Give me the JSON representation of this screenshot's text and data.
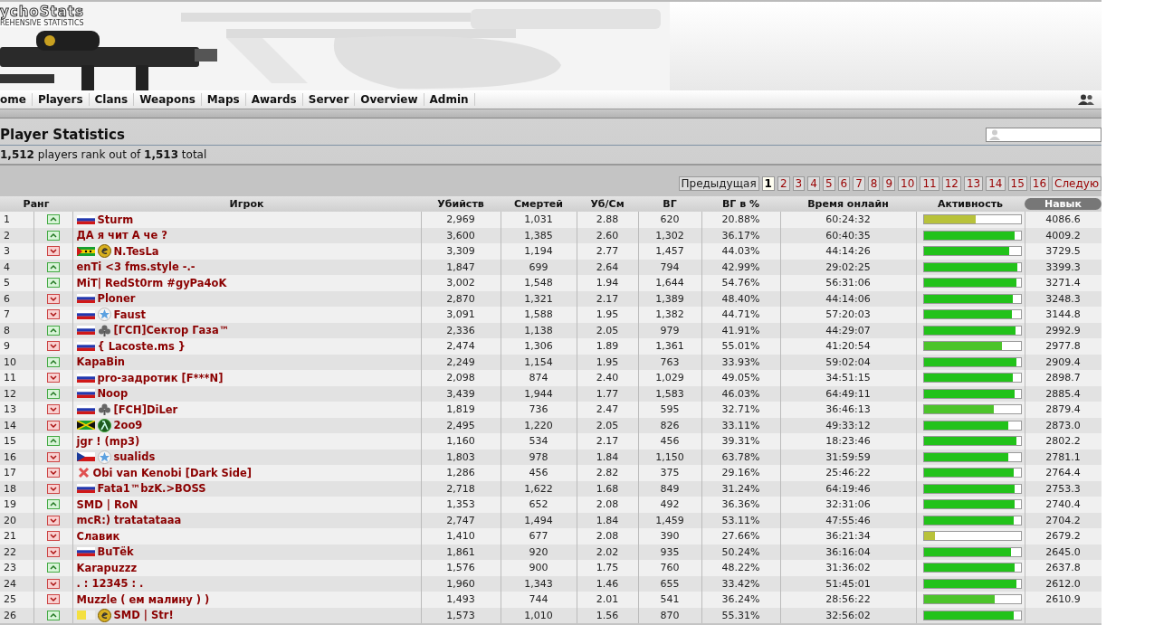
{
  "header": {
    "logo": "ychoStats",
    "tagline": "REHENSIVE STATISTICS"
  },
  "nav": [
    {
      "label": "ome"
    },
    {
      "label": "Players"
    },
    {
      "label": "Clans"
    },
    {
      "label": "Weapons"
    },
    {
      "label": "Maps"
    },
    {
      "label": "Awards"
    },
    {
      "label": "Server"
    },
    {
      "label": "Overview"
    },
    {
      "label": "Admin"
    }
  ],
  "title": "Player Statistics",
  "summary": "**1,512** players rank out of **1,513** total",
  "pagination": {
    "previous": "Предыдущая",
    "next": "Следую",
    "pages": [
      {
        "label": "1",
        "selected": true
      },
      {
        "label": "2",
        "selected": false
      },
      {
        "label": "3",
        "selected": false
      },
      {
        "label": "4",
        "selected": false
      },
      {
        "label": "5",
        "selected": false
      },
      {
        "label": "6",
        "selected": false
      },
      {
        "label": "7",
        "selected": false
      },
      {
        "label": "8",
        "selected": false
      },
      {
        "label": "9",
        "selected": false
      },
      {
        "label": "10",
        "selected": false
      },
      {
        "label": "11",
        "selected": false
      },
      {
        "label": "12",
        "selected": false
      },
      {
        "label": "13",
        "selected": false
      },
      {
        "label": "14",
        "selected": false
      },
      {
        "label": "15",
        "selected": false
      },
      {
        "label": "16",
        "selected": false
      }
    ]
  },
  "table": {
    "columns": [
      {
        "label": "Ранг",
        "sorted": false
      },
      {
        "label": "Игрок",
        "sorted": false
      },
      {
        "label": "Убийств",
        "sorted": false
      },
      {
        "label": "Смертей",
        "sorted": false
      },
      {
        "label": "Уб/См",
        "sorted": false
      },
      {
        "label": "ВГ",
        "sorted": false
      },
      {
        "label": "ВГ в %",
        "sorted": false
      },
      {
        "label": "Время онлайн",
        "sorted": false
      },
      {
        "label": "Активность",
        "sorted": false
      },
      {
        "label": "Навык",
        "sorted": true
      }
    ],
    "rows": [
      {
        "rank": "1",
        "rising": true,
        "flag": {
          "kind": "ru"
        },
        "name": "Sturm",
        "kills": "2,969",
        "deaths": "1,031",
        "kd": "2.88",
        "hs": "620",
        "hs_pct": "20.88%",
        "online": "60:24:32",
        "activity": {
          "level": 0.54,
          "color": "#b8c23a"
        },
        "skill": "4086.6"
      },
      {
        "rank": "2",
        "rising": true,
        "name": "ДА я чит А че ?",
        "kills": "3,600",
        "deaths": "1,385",
        "kd": "2.60",
        "hs": "1,302",
        "hs_pct": "36.17%",
        "online": "60:40:35",
        "activity": {
          "level": 0.94,
          "color": "#22c21a"
        },
        "skill": "4009.2"
      },
      {
        "rank": "3",
        "rising": false,
        "flag": {
          "kind": "st"
        },
        "badge": {
          "kind": "coin"
        },
        "name": "N.TesLa",
        "kills": "3,309",
        "deaths": "1,194",
        "kd": "2.77",
        "hs": "1,457",
        "hs_pct": "44.03%",
        "online": "44:14:26",
        "activity": {
          "level": 0.88,
          "color": "#22c21a"
        },
        "skill": "3729.5"
      },
      {
        "rank": "4",
        "rising": true,
        "name": "enTi <3 fms.style -.-",
        "kills": "1,847",
        "deaths": "699",
        "kd": "2.64",
        "hs": "794",
        "hs_pct": "42.99%",
        "online": "29:02:25",
        "activity": {
          "level": 0.97,
          "color": "#22c21a"
        },
        "skill": "3399.3"
      },
      {
        "rank": "5",
        "rising": true,
        "name": "MiT| RedSt0rm #gyPa4oK",
        "kills": "3,002",
        "deaths": "1,548",
        "kd": "1.94",
        "hs": "1,644",
        "hs_pct": "54.76%",
        "online": "56:31:06",
        "activity": {
          "level": 0.96,
          "color": "#22c21a"
        },
        "skill": "3271.4"
      },
      {
        "rank": "6",
        "rising": false,
        "flag": {
          "kind": "ru"
        },
        "name": "Ploner",
        "kills": "2,870",
        "deaths": "1,321",
        "kd": "2.17",
        "hs": "1,389",
        "hs_pct": "48.40%",
        "online": "44:14:06",
        "activity": {
          "level": 0.92,
          "color": "#22c21a"
        },
        "skill": "3248.3"
      },
      {
        "rank": "7",
        "rising": false,
        "flag": {
          "kind": "ru"
        },
        "badge": {
          "kind": "star"
        },
        "name": "Faust",
        "kills": "3,091",
        "deaths": "1,588",
        "kd": "1.95",
        "hs": "1,382",
        "hs_pct": "44.71%",
        "online": "57:20:03",
        "activity": {
          "level": 0.91,
          "color": "#22c21a"
        },
        "skill": "3144.8"
      },
      {
        "rank": "8",
        "rising": true,
        "flag": {
          "kind": "ru"
        },
        "badge": {
          "kind": "club"
        },
        "name": "[ГСП]Сектор Газа™",
        "kills": "2,336",
        "deaths": "1,138",
        "kd": "2.05",
        "hs": "979",
        "hs_pct": "41.91%",
        "online": "44:29:07",
        "activity": {
          "level": 0.95,
          "color": "#22c21a"
        },
        "skill": "2992.9"
      },
      {
        "rank": "9",
        "rising": false,
        "flag": {
          "kind": "ru"
        },
        "name": "{ Lacoste.ms }",
        "kills": "2,474",
        "deaths": "1,306",
        "kd": "1.89",
        "hs": "1,361",
        "hs_pct": "55.01%",
        "online": "41:20:54",
        "activity": {
          "level": 0.81,
          "color": "#4cc42a"
        },
        "skill": "2977.8"
      },
      {
        "rank": "10",
        "rising": true,
        "name": "KapaBin",
        "kills": "2,249",
        "deaths": "1,154",
        "kd": "1.95",
        "hs": "763",
        "hs_pct": "33.93%",
        "online": "59:02:04",
        "activity": {
          "level": 0.96,
          "color": "#22c21a"
        },
        "skill": "2909.4"
      },
      {
        "rank": "11",
        "rising": false,
        "flag": {
          "kind": "ru"
        },
        "name": "pro-задротик [F***N]",
        "kills": "2,098",
        "deaths": "874",
        "kd": "2.40",
        "hs": "1,029",
        "hs_pct": "49.05%",
        "online": "34:51:15",
        "activity": {
          "level": 0.92,
          "color": "#22c21a"
        },
        "skill": "2898.7"
      },
      {
        "rank": "12",
        "rising": true,
        "flag": {
          "kind": "ru"
        },
        "name": "Noop",
        "kills": "3,439",
        "deaths": "1,944",
        "kd": "1.77",
        "hs": "1,583",
        "hs_pct": "46.03%",
        "online": "64:49:11",
        "activity": {
          "level": 0.94,
          "color": "#22c21a"
        },
        "skill": "2885.4"
      },
      {
        "rank": "13",
        "rising": false,
        "flag": {
          "kind": "ru"
        },
        "badge": {
          "kind": "club"
        },
        "name": "[FCH]DiLer",
        "kills": "1,819",
        "deaths": "736",
        "kd": "2.47",
        "hs": "595",
        "hs_pct": "32.71%",
        "online": "36:46:13",
        "activity": {
          "level": 0.72,
          "color": "#4cc42a"
        },
        "skill": "2879.4"
      },
      {
        "rank": "14",
        "rising": false,
        "flag": {
          "kind": "jm"
        },
        "badge": {
          "kind": "lambda"
        },
        "name": "2oo9",
        "kills": "2,495",
        "deaths": "1,220",
        "kd": "2.05",
        "hs": "826",
        "hs_pct": "33.11%",
        "online": "49:33:12",
        "activity": {
          "level": 0.87,
          "color": "#22c21a"
        },
        "skill": "2873.0"
      },
      {
        "rank": "15",
        "rising": true,
        "name": "jgr ! (mp3)",
        "kills": "1,160",
        "deaths": "534",
        "kd": "2.17",
        "hs": "456",
        "hs_pct": "39.31%",
        "online": "18:23:46",
        "activity": {
          "level": 0.96,
          "color": "#22c21a"
        },
        "skill": "2802.2"
      },
      {
        "rank": "16",
        "rising": false,
        "flag": {
          "kind": "cz"
        },
        "badge": {
          "kind": "star"
        },
        "name": "sualids",
        "kills": "1,803",
        "deaths": "978",
        "kd": "1.84",
        "hs": "1,150",
        "hs_pct": "63.78%",
        "online": "31:59:59",
        "activity": {
          "level": 0.87,
          "color": "#22c21a"
        },
        "skill": "2781.1"
      },
      {
        "rank": "17",
        "rising": false,
        "badge": {
          "kind": "cross"
        },
        "name": "Obi van Kenobi [Dark Side]",
        "kills": "1,286",
        "deaths": "456",
        "kd": "2.82",
        "hs": "375",
        "hs_pct": "29.16%",
        "online": "25:46:22",
        "activity": {
          "level": 0.93,
          "color": "#22c21a"
        },
        "skill": "2764.4"
      },
      {
        "rank": "18",
        "rising": false,
        "flag": {
          "kind": "ru"
        },
        "name": "Fata1™bzK.>BOSS",
        "kills": "2,718",
        "deaths": "1,622",
        "kd": "1.68",
        "hs": "849",
        "hs_pct": "31.24%",
        "online": "64:19:46",
        "activity": {
          "level": 0.94,
          "color": "#22c21a"
        },
        "skill": "2753.3"
      },
      {
        "rank": "19",
        "rising": true,
        "name": "SMD | RoN",
        "kills": "1,353",
        "deaths": "652",
        "kd": "2.08",
        "hs": "492",
        "hs_pct": "36.36%",
        "online": "32:31:06",
        "activity": {
          "level": 0.94,
          "color": "#22c21a"
        },
        "skill": "2740.4"
      },
      {
        "rank": "20",
        "rising": false,
        "name": "mcR:) tratatataaa",
        "kills": "2,747",
        "deaths": "1,494",
        "kd": "1.84",
        "hs": "1,459",
        "hs_pct": "53.11%",
        "online": "47:55:46",
        "activity": {
          "level": 0.93,
          "color": "#22c21a"
        },
        "skill": "2704.2"
      },
      {
        "rank": "21",
        "rising": false,
        "name": "Славик",
        "kills": "1,410",
        "deaths": "677",
        "kd": "2.08",
        "hs": "390",
        "hs_pct": "27.66%",
        "online": "36:21:34",
        "activity": {
          "level": 0.12,
          "color": "#b8c23a"
        },
        "skill": "2679.2"
      },
      {
        "rank": "22",
        "rising": false,
        "flag": {
          "kind": "ru"
        },
        "name": "BuTёk",
        "kills": "1,861",
        "deaths": "920",
        "kd": "2.02",
        "hs": "935",
        "hs_pct": "50.24%",
        "online": "36:16:04",
        "activity": {
          "level": 0.9,
          "color": "#22c21a"
        },
        "skill": "2645.0"
      },
      {
        "rank": "23",
        "rising": true,
        "name": "Karapuzzz",
        "kills": "1,576",
        "deaths": "900",
        "kd": "1.75",
        "hs": "760",
        "hs_pct": "48.22%",
        "online": "31:36:02",
        "activity": {
          "level": 0.94,
          "color": "#22c21a"
        },
        "skill": "2637.8"
      },
      {
        "rank": "24",
        "rising": false,
        "name": ". : 12345 : .",
        "kills": "1,960",
        "deaths": "1,343",
        "kd": "1.46",
        "hs": "655",
        "hs_pct": "33.42%",
        "online": "51:45:01",
        "activity": {
          "level": 0.96,
          "color": "#22c21a"
        },
        "skill": "2612.0"
      },
      {
        "rank": "25",
        "rising": false,
        "name": "Muzzle ( ем малину ) )",
        "kills": "1,493",
        "deaths": "744",
        "kd": "2.01",
        "hs": "541",
        "hs_pct": "36.24%",
        "online": "28:56:22",
        "activity": {
          "level": 0.73,
          "color": "#4cc42a"
        },
        "skill": "2610.9"
      },
      {
        "rank": "26",
        "rising": true,
        "flag": {
          "kind": "yellow"
        },
        "badge": {
          "kind": "coin"
        },
        "name": "SMD | Str!",
        "kills": "1,573",
        "deaths": "1,010",
        "kd": "1.56",
        "hs": "870",
        "hs_pct": "55.31%",
        "online": "32:56:02",
        "activity": {
          "level": 0.93,
          "color": "#22c21a"
        }
      }
    ]
  }
}
